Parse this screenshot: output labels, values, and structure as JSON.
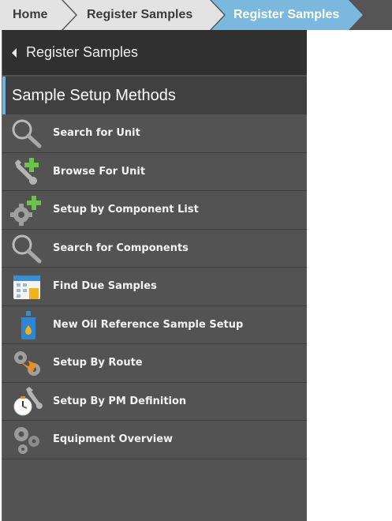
{
  "breadcrumb": {
    "items": [
      {
        "label": "Home"
      },
      {
        "label": "Register Samples"
      },
      {
        "label": "Register Samples"
      }
    ]
  },
  "panel": {
    "back_label": "Register Samples",
    "section_title": "Sample Setup Methods",
    "menu": [
      {
        "label": "Search for Unit",
        "icon": "magnifier-icon"
      },
      {
        "label": "Browse For Unit",
        "icon": "wrench-plus-icon"
      },
      {
        "label": "Setup by Component List",
        "icon": "gear-plus-icon"
      },
      {
        "label": "Search for Components",
        "icon": "magnifier-icon"
      },
      {
        "label": "Find Due Samples",
        "icon": "calendar-icon"
      },
      {
        "label": "New Oil Reference Sample Setup",
        "icon": "oil-bottle-icon"
      },
      {
        "label": "Setup By Route",
        "icon": "gears-route-icon"
      },
      {
        "label": "Setup By PM Definition",
        "icon": "wrench-clock-icon"
      },
      {
        "label": "Equipment Overview",
        "icon": "gears-icon"
      }
    ]
  },
  "colors": {
    "active_crumb": "#7ab8dd",
    "inactive_crumb": "#e3e3e3",
    "panel_bg": "#535353",
    "back_bar_bg": "#303030",
    "section_accent": "#6fb3de",
    "plus_green": "#6cc24a",
    "orange": "#f08c1e"
  }
}
